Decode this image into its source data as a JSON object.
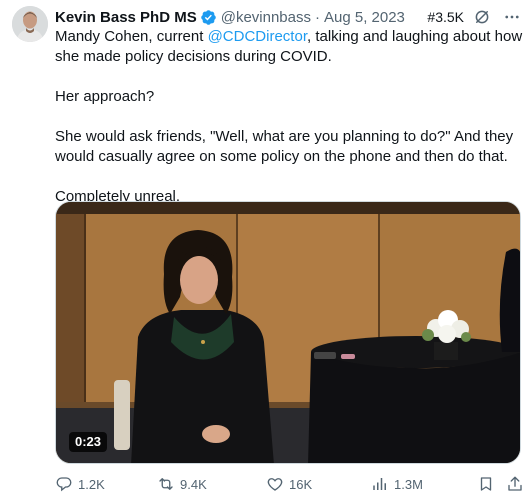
{
  "author": {
    "display_name": "Kevin Bass PhD MS",
    "handle": "@kevinnbass",
    "separator": "·",
    "date": "Aug 5, 2023",
    "verified": true
  },
  "rank_badge": "#3.5K",
  "body": {
    "line1_prefix": "Mandy Cohen, current ",
    "mention": "@CDCDirector",
    "line1_suffix": ", talking and laughing about how she made policy decisions during COVID.",
    "para2": "Her approach?",
    "para3": "She would ask friends, \"Well, what are you planning to do?\" And they would casually agree on some policy on the phone and then do that.",
    "para4": "Completely unreal."
  },
  "video": {
    "duration": "0:23"
  },
  "actions": {
    "replies": "1.2K",
    "reposts": "9.4K",
    "likes": "16K",
    "views": "1.3M"
  },
  "colors": {
    "accent": "#1d9bf0",
    "secondary_text": "#536471",
    "primary_text": "#0f1419"
  },
  "icons": [
    "verified-badge-icon",
    "grok-icon",
    "more-icon",
    "reply-icon",
    "repost-icon",
    "like-icon",
    "views-icon",
    "bookmark-icon",
    "share-icon"
  ]
}
